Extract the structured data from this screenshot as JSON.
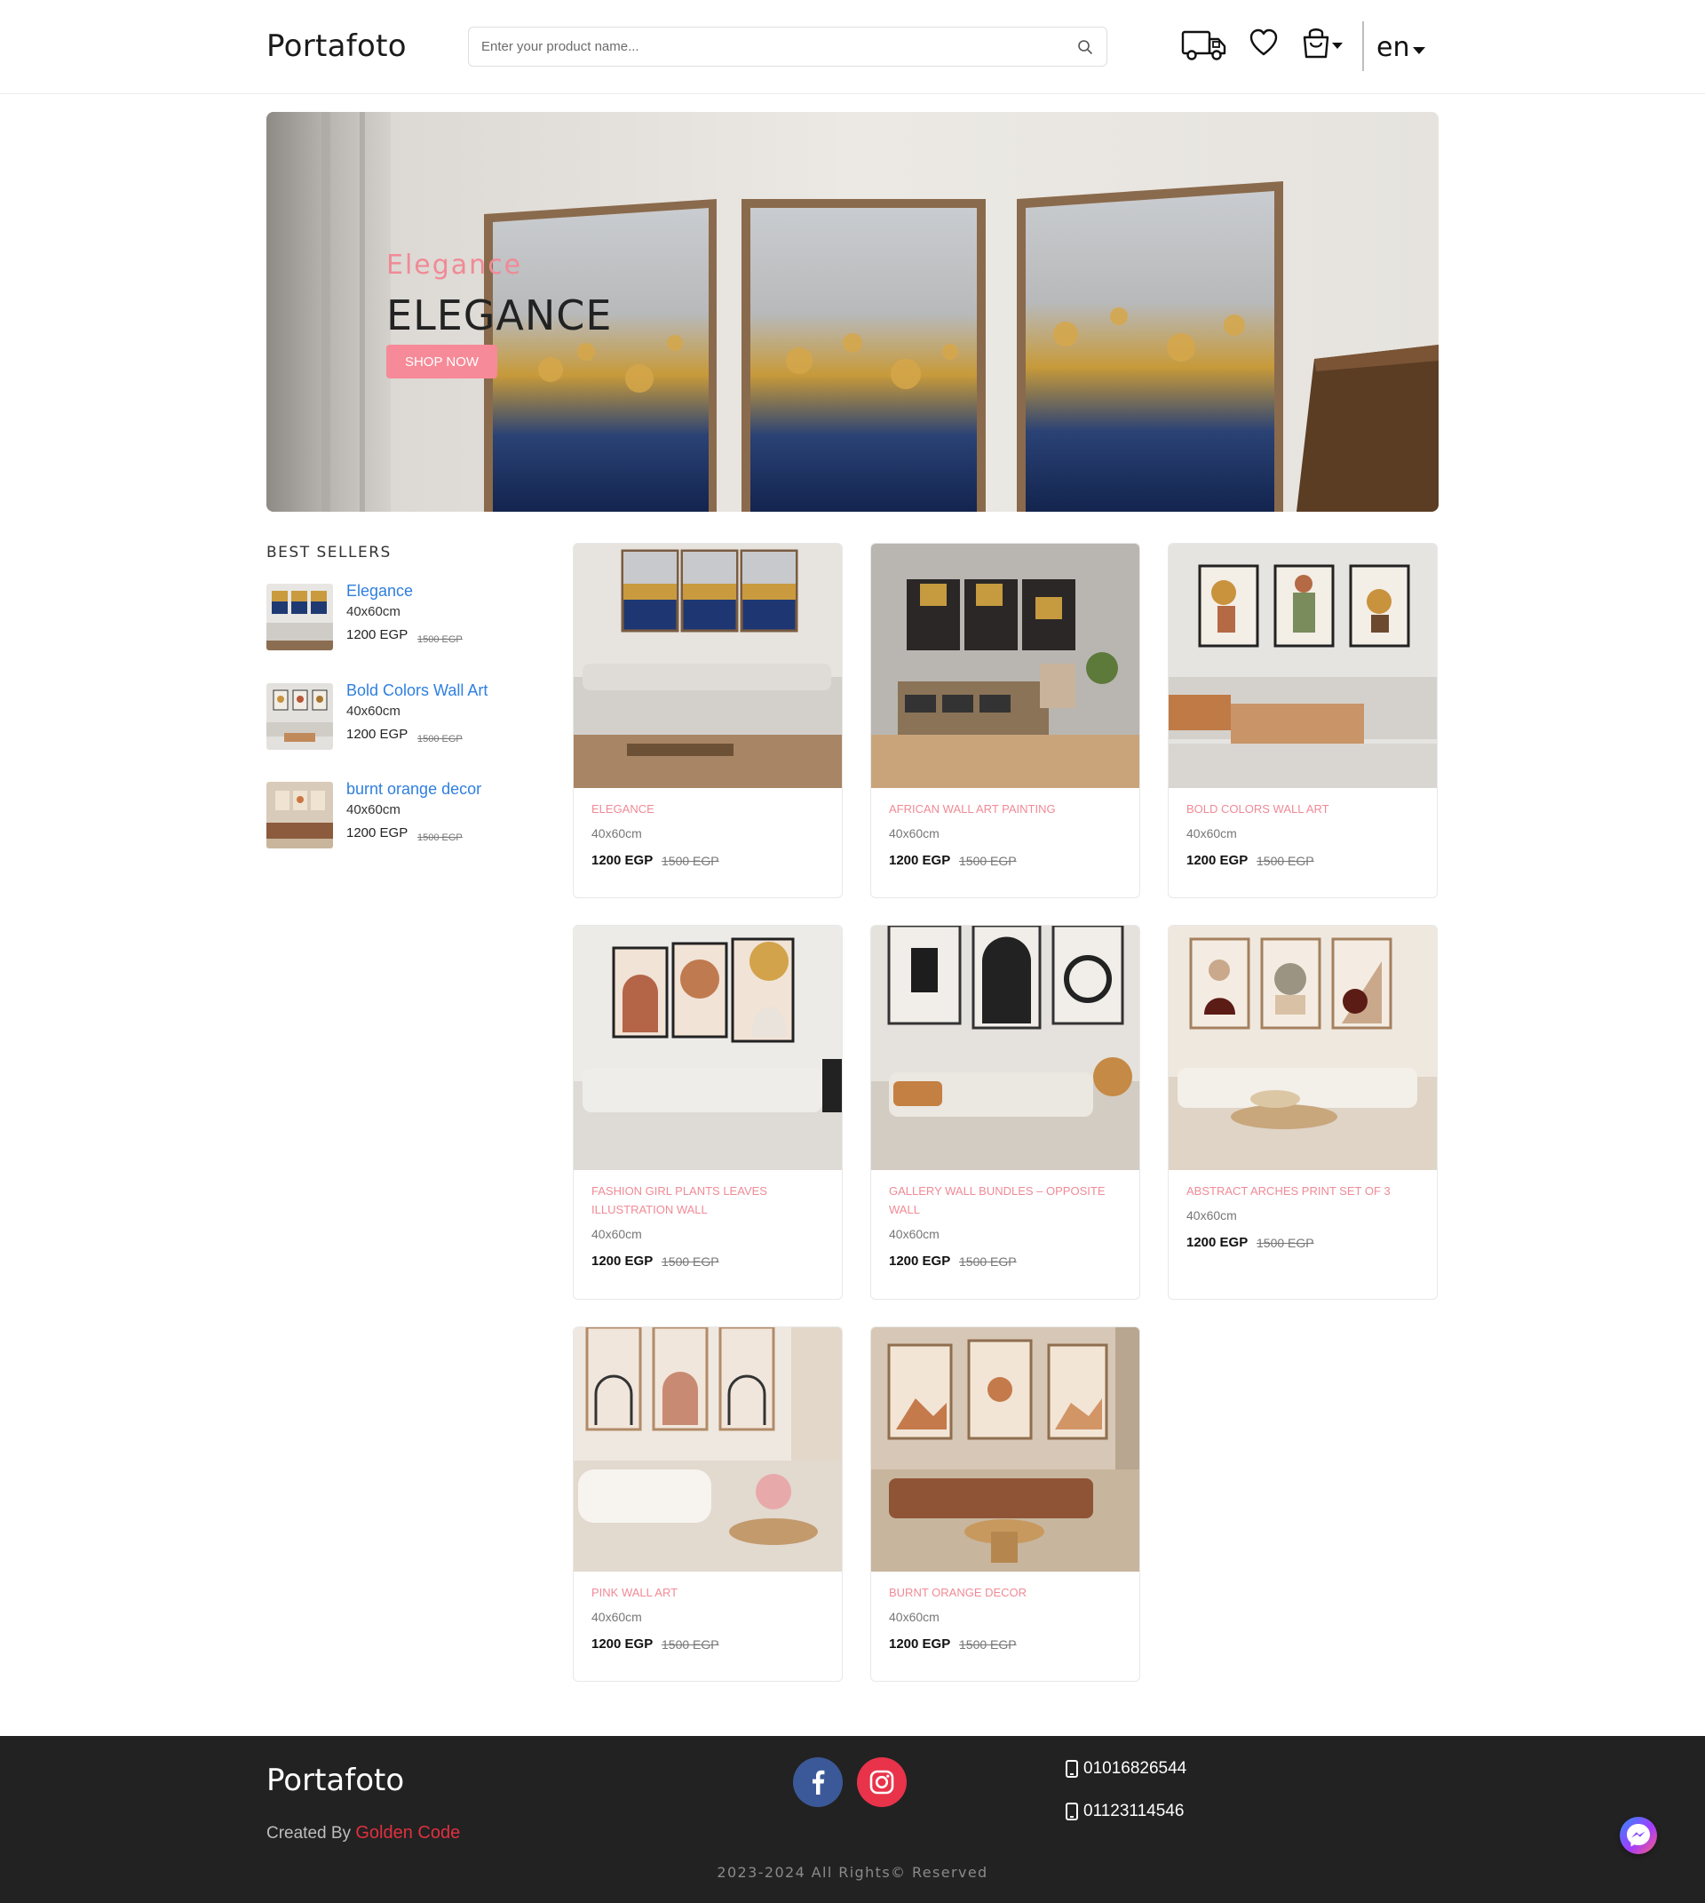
{
  "header": {
    "logo": "Portafoto",
    "search_placeholder": "Enter your product name...",
    "icons": [
      "truck-icon",
      "heart-icon",
      "shopping-bag-icon",
      "search-icon"
    ],
    "language": "en"
  },
  "hero": {
    "subtitle": "Elegance",
    "title": "ELEGANCE",
    "button": "SHOP NOW"
  },
  "best_sellers": {
    "title": "BEST SELLERS",
    "items": [
      {
        "name": "Elegance",
        "size": "40x60cm",
        "price": "1200 EGP",
        "old_price": "1500 EGP"
      },
      {
        "name": "Bold Colors Wall Art",
        "size": "40x60cm",
        "price": "1200 EGP",
        "old_price": "1500 EGP"
      },
      {
        "name": "burnt orange decor",
        "size": "40x60cm",
        "price": "1200 EGP",
        "old_price": "1500 EGP"
      }
    ]
  },
  "products": [
    {
      "name": "ELEGANCE",
      "size": "40x60cm",
      "price": "1200 EGP",
      "old_price": "1500 EGP"
    },
    {
      "name": "AFRICAN WALL ART PAINTING",
      "size": "40x60cm",
      "price": "1200 EGP",
      "old_price": "1500 EGP"
    },
    {
      "name": "BOLD COLORS WALL ART",
      "size": "40x60cm",
      "price": "1200 EGP",
      "old_price": "1500 EGP"
    },
    {
      "name": "FASHION GIRL PLANTS LEAVES ILLUSTRATION WALL",
      "size": "40x60cm",
      "price": "1200 EGP",
      "old_price": "1500 EGP"
    },
    {
      "name": "GALLERY WALL BUNDLES – OPPOSITE WALL",
      "size": "40x60cm",
      "price": "1200 EGP",
      "old_price": "1500 EGP"
    },
    {
      "name": "ABSTRACT ARCHES PRINT SET OF 3",
      "size": "40x60cm",
      "price": "1200 EGP",
      "old_price": "1500 EGP"
    },
    {
      "name": "PINK WALL ART",
      "size": "40x60cm",
      "price": "1200 EGP",
      "old_price": "1500 EGP"
    },
    {
      "name": "BURNT ORANGE DECOR",
      "size": "40x60cm",
      "price": "1200 EGP",
      "old_price": "1500 EGP"
    }
  ],
  "footer": {
    "logo": "Portafoto",
    "created_by": "Created By",
    "creator": "Golden Code",
    "phones": [
      "01016826544",
      "01123114546"
    ],
    "copyright": "2023-2024 All Rights© Reserved",
    "social_icons": [
      "facebook-icon",
      "instagram-icon"
    ]
  },
  "colors": {
    "accent_pink": "#f78a98",
    "link_blue": "#2f7fdf",
    "footer_bg": "#222222",
    "creator_red": "#e0303f"
  }
}
